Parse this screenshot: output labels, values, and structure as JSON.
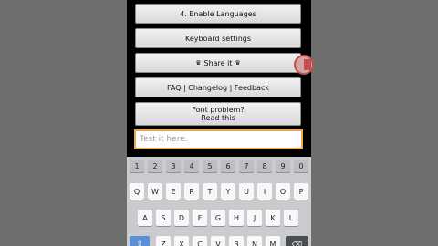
{
  "menu": {
    "enable_languages": "4. Enable Languages",
    "keyboard_settings": "Keyboard settings",
    "share_it": "Share it",
    "faq": "FAQ | Changelog | Feedback",
    "font_problem_line1": "Font problem?",
    "font_problem_line2": "Read this"
  },
  "input": {
    "placeholder": "Test it here."
  },
  "keyboard": {
    "numbers": [
      "1",
      "2",
      "3",
      "4",
      "5",
      "6",
      "7",
      "8",
      "9",
      "0"
    ],
    "row1": [
      "Q",
      "W",
      "E",
      "R",
      "T",
      "Y",
      "U",
      "I",
      "O",
      "P"
    ],
    "row2": [
      "A",
      "S",
      "D",
      "F",
      "G",
      "H",
      "J",
      "K",
      "L"
    ],
    "row3": [
      "Z",
      "X",
      "C",
      "V",
      "B",
      "N",
      "M"
    ],
    "shift_icon": "shift-icon",
    "backspace_icon": "backspace-icon"
  },
  "colors": {
    "input_border": "#f0a74a",
    "shift_key": "#5b8fd6"
  }
}
